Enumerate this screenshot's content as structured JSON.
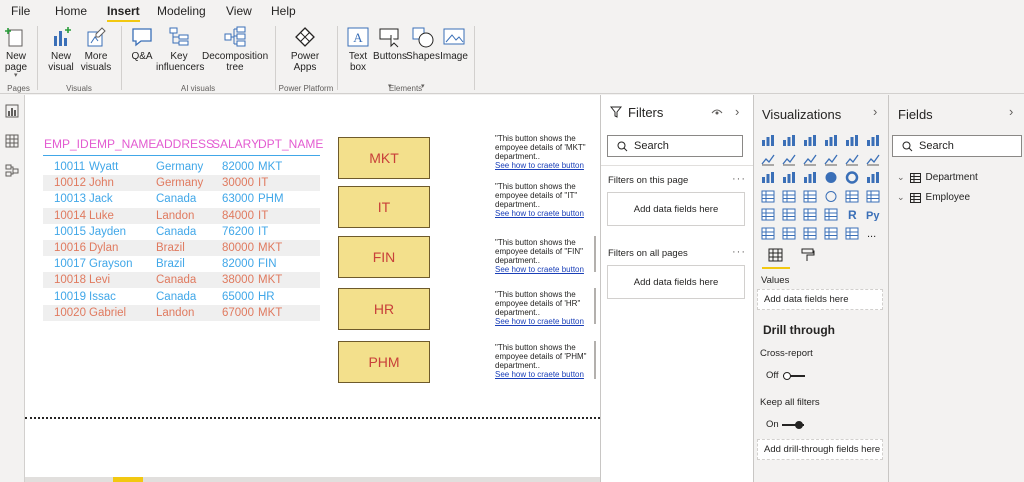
{
  "menu": {
    "tabs": [
      "File",
      "Home",
      "Insert",
      "Modeling",
      "View",
      "Help"
    ],
    "active": "Insert"
  },
  "ribbon": {
    "buttons": [
      {
        "id": "new-page",
        "label": "New page",
        "icon": "new-page-icon"
      },
      {
        "id": "new-visual",
        "label": "New visual",
        "icon": "new-visual-icon"
      },
      {
        "id": "more-visuals",
        "label": "More visuals",
        "icon": "more-visuals-icon"
      },
      {
        "id": "qa",
        "label": "Q&A",
        "icon": "qa-icon"
      },
      {
        "id": "key-influencers",
        "label": "Key influencers",
        "icon": "key-influencers-icon"
      },
      {
        "id": "decomposition-tree",
        "label": "Decomposition tree",
        "icon": "decomposition-tree-icon"
      },
      {
        "id": "power-apps",
        "label": "Power Apps",
        "icon": "power-apps-icon"
      },
      {
        "id": "text-box",
        "label": "Text box",
        "icon": "text-box-icon"
      },
      {
        "id": "buttons",
        "label": "Buttons",
        "icon": "buttons-icon"
      },
      {
        "id": "shapes",
        "label": "Shapes",
        "icon": "shapes-icon"
      },
      {
        "id": "image",
        "label": "Image",
        "icon": "image-icon"
      }
    ],
    "groups": [
      "Pages",
      "Visuals",
      "AI visuals",
      "Power Platform",
      "Elements"
    ]
  },
  "table": {
    "headers": [
      "EMP_ID",
      "EMP_NAME",
      "ADDRESS",
      "SALARY",
      "DPT_NAME"
    ],
    "rows": [
      [
        "10011",
        "Wyatt",
        "Germany",
        "82000",
        "MKT"
      ],
      [
        "10012",
        "John",
        "Germany",
        "30000",
        "IT"
      ],
      [
        "10013",
        "Jack",
        "Canada",
        "63000",
        "PHM"
      ],
      [
        "10014",
        "Luke",
        "Landon",
        "84000",
        "IT"
      ],
      [
        "10015",
        "Jayden",
        "Canada",
        "76200",
        "IT"
      ],
      [
        "10016",
        "Dylan",
        "Brazil",
        "80000",
        "MKT"
      ],
      [
        "10017",
        "Grayson",
        "Brazil",
        "82000",
        "FIN"
      ],
      [
        "10018",
        "Levi",
        "Canada",
        "38000",
        "MKT"
      ],
      [
        "10019",
        "Issac",
        "Canada",
        "65000",
        "HR"
      ],
      [
        "10020",
        "Gabriel",
        "Landon",
        "67000",
        "MKT"
      ]
    ]
  },
  "dept_buttons": [
    "MKT",
    "IT",
    "FIN",
    "HR",
    "PHM"
  ],
  "descriptions": [
    {
      "line1": "\"This button shows the",
      "line2": "empoyee details of 'MKT\"",
      "line3": "department..",
      "link": "See how to craete button"
    },
    {
      "line1": "\"This button shows the",
      "line2": "empoyee details of \"IT\"",
      "line3": "department..",
      "link": "See how to craete button"
    },
    {
      "line1": "\"This button shows the",
      "line2": "empoyee details of \"FIN\"",
      "line3": "department..",
      "link": "See how to craete button"
    },
    {
      "line1": "\"This button shows the",
      "line2": "empoyee details of 'HR\"",
      "line3": "department..",
      "link": "See how to craete button"
    },
    {
      "line1": "\"This button shows the",
      "line2": "empoyee details of 'PHM\"",
      "line3": "department..",
      "link": "See how to craete button"
    }
  ],
  "filters": {
    "title": "Filters",
    "search_placeholder": "Search",
    "on_this_page": "Filters on this page",
    "on_all_pages": "Filters on all pages",
    "add_fields": "Add data fields here"
  },
  "visualizations": {
    "title": "Visualizations",
    "values_label": "Values",
    "add_fields": "Add data fields here",
    "drill_through": "Drill through",
    "cross_report": "Cross-report",
    "cross_report_state": "Off",
    "keep_all_filters": "Keep all filters",
    "keep_all_filters_state": "On",
    "add_drill": "Add drill-through fields here",
    "r_icon_text": "R",
    "py_icon_text": "Py",
    "more": "..."
  },
  "fields": {
    "title": "Fields",
    "search_placeholder": "Search",
    "tables": [
      "Department",
      "Employee"
    ]
  },
  "colors": {
    "header": "#e35bd1",
    "blue_row": "#41a7e8",
    "orange_row": "#e07a5f",
    "button_fill": "#f3e08c",
    "button_text": "#c8403a",
    "accent": "#f2c811"
  }
}
